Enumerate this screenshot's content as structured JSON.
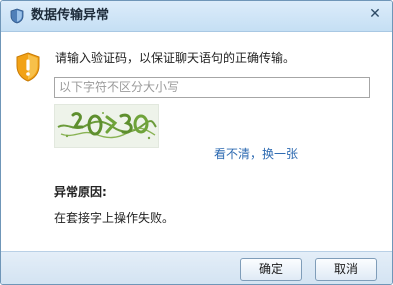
{
  "window": {
    "title": "数据传输异常",
    "close_glyph": "✕"
  },
  "main": {
    "prompt": "请输入验证码，以保证聊天语句的正确传输。",
    "input_placeholder": "以下字符不区分大小写",
    "refresh_link": "看不清，换一张",
    "reason_title": "异常原因:",
    "reason_text": "在套接字上操作失败。"
  },
  "footer": {
    "ok_label": "确定",
    "cancel_label": "取消"
  },
  "colors": {
    "link": "#2d6ab1",
    "warning": "#f2a216"
  }
}
